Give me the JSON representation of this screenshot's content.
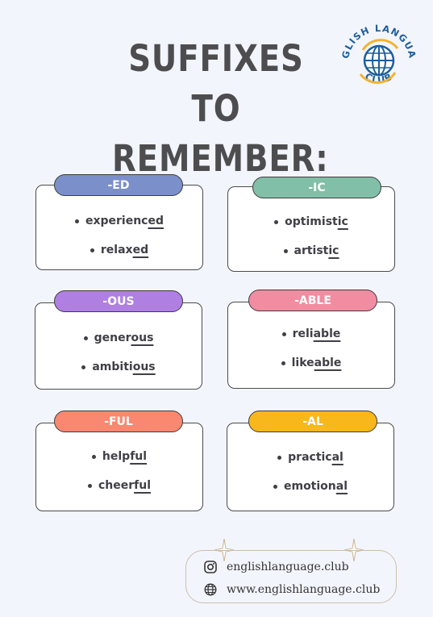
{
  "title": {
    "line1": "SUFFIXES TO",
    "line2": "REMEMBER:"
  },
  "logo": {
    "top_text": "ENGLISH LANGUAGE",
    "bottom_text": "CLUB"
  },
  "cards": [
    {
      "suffix": "-ED",
      "color": "#7b8fca",
      "words": [
        {
          "stem": "experienc",
          "suffix": "ed"
        },
        {
          "stem": "relax",
          "suffix": "ed"
        }
      ]
    },
    {
      "suffix": "-IC",
      "color": "#82bfa8",
      "words": [
        {
          "stem": "optimist",
          "suffix": "ic"
        },
        {
          "stem": "artist",
          "suffix": "ic"
        }
      ]
    },
    {
      "suffix": "-OUS",
      "color": "#b07fe2",
      "words": [
        {
          "stem": "gener",
          "suffix": "ous"
        },
        {
          "stem": "ambiti",
          "suffix": "ous"
        }
      ]
    },
    {
      "suffix": "-ABLE",
      "color": "#f28ca0",
      "words": [
        {
          "stem": "reli",
          "suffix": "able"
        },
        {
          "stem": "like",
          "suffix": "able"
        }
      ]
    },
    {
      "suffix": "-FUL",
      "color": "#fa8870",
      "words": [
        {
          "stem": "help",
          "suffix": "ful"
        },
        {
          "stem": "cheer",
          "suffix": "ful"
        }
      ]
    },
    {
      "suffix": "-AL",
      "color": "#f8b71b",
      "words": [
        {
          "stem": "practic",
          "suffix": "al"
        },
        {
          "stem": "emotion",
          "suffix": "al"
        }
      ]
    }
  ],
  "footer": {
    "instagram": "englishlanguage.club",
    "website": "www.englishlanguage.club"
  },
  "icons": [
    "globe-icon",
    "instagram-icon",
    "web-icon",
    "sparkle-icon"
  ]
}
